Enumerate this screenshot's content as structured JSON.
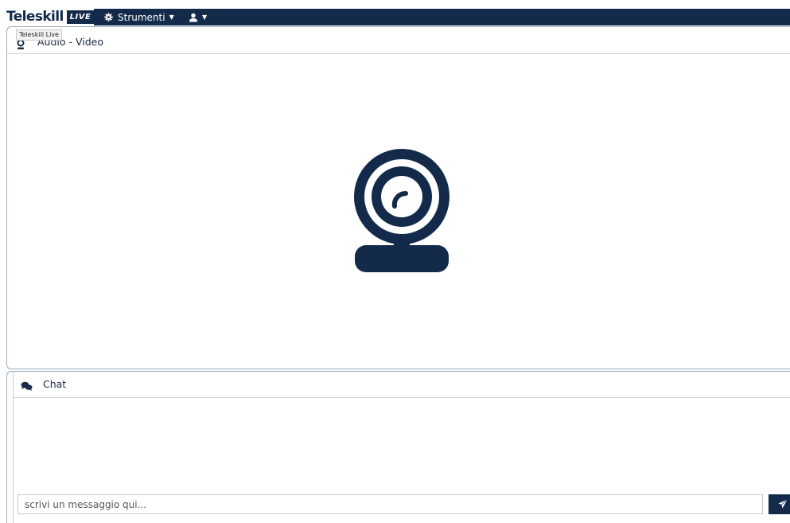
{
  "app": {
    "brand": "Teleskill",
    "live_badge": "LIVE",
    "tooltip": "Teleskill Live"
  },
  "navbar": {
    "tools_menu_label": "Strumenti",
    "tools_icon": "gear-icon",
    "user_icon": "user-icon",
    "background": "#132a4a"
  },
  "audio_video": {
    "title": "Audio - Video",
    "icon": "webcam-icon",
    "placeholder_icon": "webcam-icon"
  },
  "chat": {
    "title": "Chat",
    "icon": "comments-icon",
    "input_placeholder": "scrivi un messaggio qui...",
    "input_value": "",
    "send_icon": "paper-plane-icon"
  },
  "colors": {
    "primary": "#132a4a",
    "border": "#9aaabb"
  }
}
